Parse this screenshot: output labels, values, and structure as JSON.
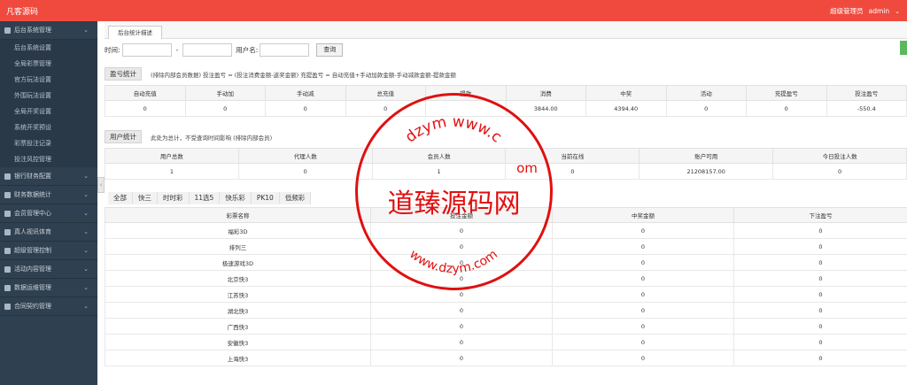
{
  "header": {
    "brand": "凡客源码",
    "role": "超级管理员",
    "user": "admin"
  },
  "sidebar": {
    "groups": [
      {
        "label": "后台系统管理",
        "expanded": true,
        "items": [
          "后台系统设置",
          "全局彩票管理",
          "官方玩法设置",
          "外围玩法设置",
          "全局开奖设置",
          "系统开奖预设",
          "彩票投注记录",
          "投注风控管理"
        ]
      },
      {
        "label": "银行财务配置"
      },
      {
        "label": "财务数据统计"
      },
      {
        "label": "会员管理中心"
      },
      {
        "label": "真人视讯体育"
      },
      {
        "label": "超级管理控制"
      },
      {
        "label": "活动内容管理"
      },
      {
        "label": "数据运维管理"
      },
      {
        "label": "合同契约管理"
      }
    ]
  },
  "tab": {
    "label": "后台统计描述"
  },
  "filter": {
    "time_label": "时间:",
    "sep": "-",
    "user_label": "用户名:",
    "search_btn": "查询"
  },
  "profit": {
    "tag": "盈亏统计",
    "note": "(排除内部会员数据) 投注盈亏 = (投注消费金额-返奖金额)    充提盈亏 = 自动充值+手动加款金额-手动减款金额-提款金额",
    "headers": [
      "自动充值",
      "手动加",
      "手动减",
      "总充值",
      "提款",
      "消费",
      "中奖",
      "活动",
      "充提盈亏",
      "投注盈亏"
    ],
    "row": [
      "0",
      "0",
      "0",
      "0",
      "",
      "3844.00",
      "4394.40",
      "0",
      "0",
      "-550.4"
    ]
  },
  "users": {
    "tag": "用户统计",
    "note": "此处为总计，不受查询时间影响 (排除内部会员)",
    "headers": [
      "用户总数",
      "代理人数",
      "会员人数",
      "当前在线",
      "账户可用",
      "今日投注人数"
    ],
    "row": [
      "1",
      "0",
      "1",
      "0",
      "21208157.00",
      "0"
    ]
  },
  "lottery_tabs": [
    "全部",
    "快三",
    "时时彩",
    "11选5",
    "快乐彩",
    "PK10",
    "低频彩"
  ],
  "lottery": {
    "headers": [
      "彩票名称",
      "投注金额",
      "中奖金额",
      "下注盈亏"
    ],
    "rows": [
      [
        "福彩3D",
        "0",
        "0",
        "0"
      ],
      [
        "排列三",
        "0",
        "0",
        "0"
      ],
      [
        "极速游戏3D",
        "0",
        "0",
        "0"
      ],
      [
        "北京快3",
        "0",
        "0",
        "0"
      ],
      [
        "江苏快3",
        "0",
        "0",
        "0"
      ],
      [
        "湖北快3",
        "0",
        "0",
        "0"
      ],
      [
        "广西快3",
        "0",
        "0",
        "0"
      ],
      [
        "安徽快3",
        "0",
        "0",
        "0"
      ],
      [
        "上海快3",
        "0",
        "0",
        "0"
      ]
    ]
  },
  "watermark": {
    "center": "道臻源码网",
    "ring_top": "dzym www.c",
    "ring_om": "om",
    "ring_bottom": "www.dzym.com",
    "color": "#e01010"
  }
}
